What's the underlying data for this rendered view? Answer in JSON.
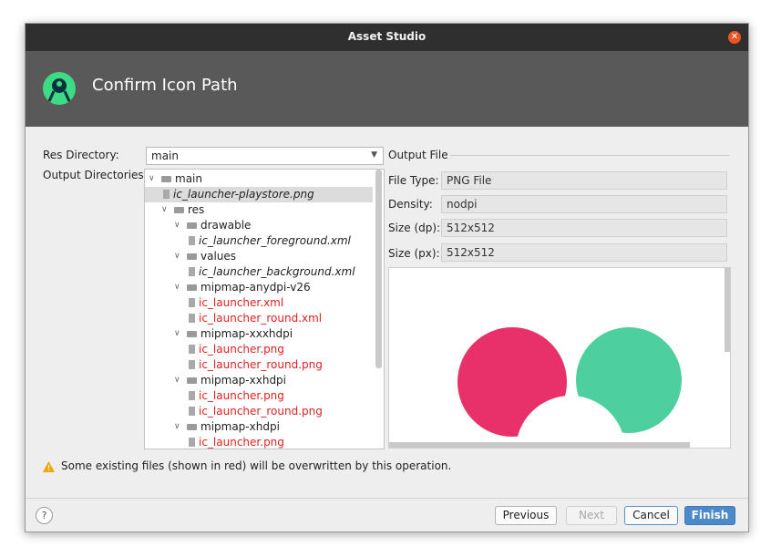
{
  "window": {
    "title": "Asset Studio"
  },
  "banner": {
    "title": "Confirm Icon Path"
  },
  "form": {
    "res_directory_label": "Res Directory:",
    "res_directory_value": "main",
    "output_directories_label": "Output Directories:"
  },
  "tree": [
    {
      "text": "main",
      "kind": "folder",
      "depth": 0,
      "expanded": true,
      "style": "normal"
    },
    {
      "text": "ic_launcher-playstore.png",
      "kind": "file",
      "depth": 1,
      "style": "italic",
      "selected": true
    },
    {
      "text": "res",
      "kind": "folder",
      "depth": 1,
      "expanded": true,
      "style": "normal"
    },
    {
      "text": "drawable",
      "kind": "folder",
      "depth": 2,
      "expanded": true,
      "style": "normal"
    },
    {
      "text": "ic_launcher_foreground.xml",
      "kind": "file",
      "depth": 3,
      "style": "italic"
    },
    {
      "text": "values",
      "kind": "folder",
      "depth": 2,
      "expanded": true,
      "style": "normal"
    },
    {
      "text": "ic_launcher_background.xml",
      "kind": "file",
      "depth": 3,
      "style": "italic"
    },
    {
      "text": "mipmap-anydpi-v26",
      "kind": "folder",
      "depth": 2,
      "expanded": true,
      "style": "normal"
    },
    {
      "text": "ic_launcher.xml",
      "kind": "file",
      "depth": 3,
      "style": "red"
    },
    {
      "text": "ic_launcher_round.xml",
      "kind": "file",
      "depth": 3,
      "style": "red"
    },
    {
      "text": "mipmap-xxxhdpi",
      "kind": "folder",
      "depth": 2,
      "expanded": true,
      "style": "normal"
    },
    {
      "text": "ic_launcher.png",
      "kind": "file",
      "depth": 3,
      "style": "red"
    },
    {
      "text": "ic_launcher_round.png",
      "kind": "file",
      "depth": 3,
      "style": "red"
    },
    {
      "text": "mipmap-xxhdpi",
      "kind": "folder",
      "depth": 2,
      "expanded": true,
      "style": "normal"
    },
    {
      "text": "ic_launcher.png",
      "kind": "file",
      "depth": 3,
      "style": "red"
    },
    {
      "text": "ic_launcher_round.png",
      "kind": "file",
      "depth": 3,
      "style": "red"
    },
    {
      "text": "mipmap-xhdpi",
      "kind": "folder",
      "depth": 2,
      "expanded": true,
      "style": "normal"
    },
    {
      "text": "ic_launcher.png",
      "kind": "file",
      "depth": 3,
      "style": "red"
    }
  ],
  "output_file": {
    "header": "Output File",
    "fields": [
      {
        "label": "File Type:",
        "value": "PNG File"
      },
      {
        "label": "Density:",
        "value": "nodpi"
      },
      {
        "label": "Size (dp):",
        "value": "512x512"
      },
      {
        "label": "Size (px):",
        "value": "512x512"
      }
    ]
  },
  "warning": {
    "text": "Some existing files (shown in red) will be overwritten by this operation."
  },
  "buttons": {
    "help": "?",
    "previous": "Previous",
    "next": "Next",
    "cancel": "Cancel",
    "finish": "Finish"
  },
  "colors": {
    "titlebar": "#2f2f2f",
    "banner": "#595959",
    "overwritten_text": "#e02020",
    "finish_button": "#4d8ac9",
    "preview_pink": "#e8306a",
    "preview_green": "#4ecfa0"
  },
  "icons": {
    "close": "close-icon",
    "logo": "android-studio-logo",
    "warning": "warning-icon",
    "dropdown": "chevron-down-icon",
    "folder": "folder-icon",
    "file": "file-icon"
  }
}
